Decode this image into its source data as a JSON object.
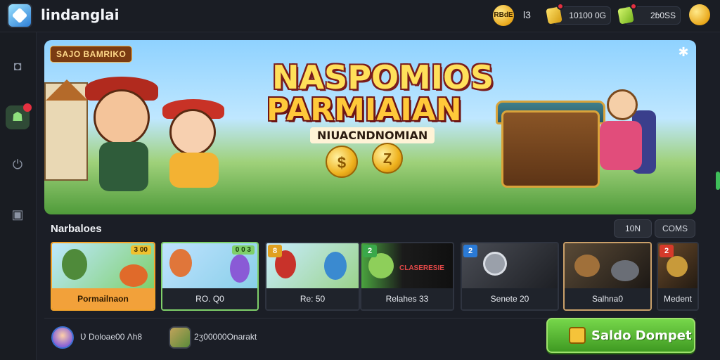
{
  "header": {
    "app_title": "lindanglai",
    "coin_label": "RBdE",
    "count": "l3",
    "wallet_gold": "10100 0G",
    "wallet_green": "2ɓ0SS"
  },
  "sidebar": {
    "items": [
      {
        "icon": "camera-icon",
        "glyph": "◘"
      },
      {
        "icon": "user-icon",
        "glyph": "☗"
      },
      {
        "icon": "power-icon",
        "glyph": "⏻"
      },
      {
        "icon": "wallet-icon",
        "glyph": "▣"
      }
    ]
  },
  "banner": {
    "tag": "SAJO BAMRIKO",
    "title_line1": "NASPOMIOS",
    "title_line2": "PARMIAIAN",
    "subtitle": "NIUACNDNOMIAN",
    "close_glyph": "✱",
    "coin_glyph_1": "$",
    "coin_glyph_2": "Ȥ"
  },
  "section": {
    "title": "Narbaloes",
    "pill_1": "10N",
    "pill_2": "COMS"
  },
  "cards": [
    {
      "label": "Pormailnaon",
      "badge": "3 00"
    },
    {
      "label": "RO. Q0",
      "badge": "0 0 3"
    },
    {
      "label": "Re: 50",
      "badge": "8"
    },
    {
      "label": "Relahes 33",
      "badge": "2",
      "art_text": "CLASERESIE"
    },
    {
      "label": "Senete 20",
      "badge": "2"
    },
    {
      "label": "Salhna0",
      "badge": ""
    },
    {
      "label": "Medent",
      "badge": "2"
    }
  ],
  "footer": {
    "user_text": "Ʋ   Doloae00 Λh8",
    "reward_text": "2ʒ00000Onarakt",
    "cta_label": "Saldo Dompet"
  },
  "colors": {
    "accent_green": "#5fbf35",
    "accent_gold": "#f2a13a",
    "notify_red": "#e53040",
    "bg": "#1b1e26"
  }
}
